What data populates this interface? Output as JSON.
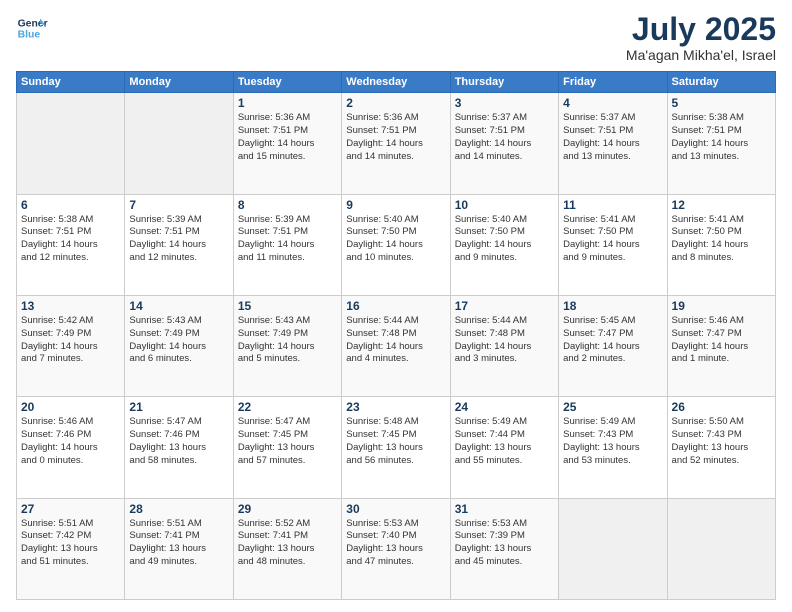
{
  "logo": {
    "line1": "General",
    "line2": "Blue"
  },
  "title": "July 2025",
  "subtitle": "Ma'agan Mikha'el, Israel",
  "days_header": [
    "Sunday",
    "Monday",
    "Tuesday",
    "Wednesday",
    "Thursday",
    "Friday",
    "Saturday"
  ],
  "weeks": [
    [
      {
        "day": "",
        "sunrise": "",
        "sunset": "",
        "daylight": ""
      },
      {
        "day": "",
        "sunrise": "",
        "sunset": "",
        "daylight": ""
      },
      {
        "day": "1",
        "sunrise": "Sunrise: 5:36 AM",
        "sunset": "Sunset: 7:51 PM",
        "daylight": "Daylight: 14 hours and 15 minutes."
      },
      {
        "day": "2",
        "sunrise": "Sunrise: 5:36 AM",
        "sunset": "Sunset: 7:51 PM",
        "daylight": "Daylight: 14 hours and 14 minutes."
      },
      {
        "day": "3",
        "sunrise": "Sunrise: 5:37 AM",
        "sunset": "Sunset: 7:51 PM",
        "daylight": "Daylight: 14 hours and 14 minutes."
      },
      {
        "day": "4",
        "sunrise": "Sunrise: 5:37 AM",
        "sunset": "Sunset: 7:51 PM",
        "daylight": "Daylight: 14 hours and 13 minutes."
      },
      {
        "day": "5",
        "sunrise": "Sunrise: 5:38 AM",
        "sunset": "Sunset: 7:51 PM",
        "daylight": "Daylight: 14 hours and 13 minutes."
      }
    ],
    [
      {
        "day": "6",
        "sunrise": "Sunrise: 5:38 AM",
        "sunset": "Sunset: 7:51 PM",
        "daylight": "Daylight: 14 hours and 12 minutes."
      },
      {
        "day": "7",
        "sunrise": "Sunrise: 5:39 AM",
        "sunset": "Sunset: 7:51 PM",
        "daylight": "Daylight: 14 hours and 12 minutes."
      },
      {
        "day": "8",
        "sunrise": "Sunrise: 5:39 AM",
        "sunset": "Sunset: 7:51 PM",
        "daylight": "Daylight: 14 hours and 11 minutes."
      },
      {
        "day": "9",
        "sunrise": "Sunrise: 5:40 AM",
        "sunset": "Sunset: 7:50 PM",
        "daylight": "Daylight: 14 hours and 10 minutes."
      },
      {
        "day": "10",
        "sunrise": "Sunrise: 5:40 AM",
        "sunset": "Sunset: 7:50 PM",
        "daylight": "Daylight: 14 hours and 9 minutes."
      },
      {
        "day": "11",
        "sunrise": "Sunrise: 5:41 AM",
        "sunset": "Sunset: 7:50 PM",
        "daylight": "Daylight: 14 hours and 9 minutes."
      },
      {
        "day": "12",
        "sunrise": "Sunrise: 5:41 AM",
        "sunset": "Sunset: 7:50 PM",
        "daylight": "Daylight: 14 hours and 8 minutes."
      }
    ],
    [
      {
        "day": "13",
        "sunrise": "Sunrise: 5:42 AM",
        "sunset": "Sunset: 7:49 PM",
        "daylight": "Daylight: 14 hours and 7 minutes."
      },
      {
        "day": "14",
        "sunrise": "Sunrise: 5:43 AM",
        "sunset": "Sunset: 7:49 PM",
        "daylight": "Daylight: 14 hours and 6 minutes."
      },
      {
        "day": "15",
        "sunrise": "Sunrise: 5:43 AM",
        "sunset": "Sunset: 7:49 PM",
        "daylight": "Daylight: 14 hours and 5 minutes."
      },
      {
        "day": "16",
        "sunrise": "Sunrise: 5:44 AM",
        "sunset": "Sunset: 7:48 PM",
        "daylight": "Daylight: 14 hours and 4 minutes."
      },
      {
        "day": "17",
        "sunrise": "Sunrise: 5:44 AM",
        "sunset": "Sunset: 7:48 PM",
        "daylight": "Daylight: 14 hours and 3 minutes."
      },
      {
        "day": "18",
        "sunrise": "Sunrise: 5:45 AM",
        "sunset": "Sunset: 7:47 PM",
        "daylight": "Daylight: 14 hours and 2 minutes."
      },
      {
        "day": "19",
        "sunrise": "Sunrise: 5:46 AM",
        "sunset": "Sunset: 7:47 PM",
        "daylight": "Daylight: 14 hours and 1 minute."
      }
    ],
    [
      {
        "day": "20",
        "sunrise": "Sunrise: 5:46 AM",
        "sunset": "Sunset: 7:46 PM",
        "daylight": "Daylight: 14 hours and 0 minutes."
      },
      {
        "day": "21",
        "sunrise": "Sunrise: 5:47 AM",
        "sunset": "Sunset: 7:46 PM",
        "daylight": "Daylight: 13 hours and 58 minutes."
      },
      {
        "day": "22",
        "sunrise": "Sunrise: 5:47 AM",
        "sunset": "Sunset: 7:45 PM",
        "daylight": "Daylight: 13 hours and 57 minutes."
      },
      {
        "day": "23",
        "sunrise": "Sunrise: 5:48 AM",
        "sunset": "Sunset: 7:45 PM",
        "daylight": "Daylight: 13 hours and 56 minutes."
      },
      {
        "day": "24",
        "sunrise": "Sunrise: 5:49 AM",
        "sunset": "Sunset: 7:44 PM",
        "daylight": "Daylight: 13 hours and 55 minutes."
      },
      {
        "day": "25",
        "sunrise": "Sunrise: 5:49 AM",
        "sunset": "Sunset: 7:43 PM",
        "daylight": "Daylight: 13 hours and 53 minutes."
      },
      {
        "day": "26",
        "sunrise": "Sunrise: 5:50 AM",
        "sunset": "Sunset: 7:43 PM",
        "daylight": "Daylight: 13 hours and 52 minutes."
      }
    ],
    [
      {
        "day": "27",
        "sunrise": "Sunrise: 5:51 AM",
        "sunset": "Sunset: 7:42 PM",
        "daylight": "Daylight: 13 hours and 51 minutes."
      },
      {
        "day": "28",
        "sunrise": "Sunrise: 5:51 AM",
        "sunset": "Sunset: 7:41 PM",
        "daylight": "Daylight: 13 hours and 49 minutes."
      },
      {
        "day": "29",
        "sunrise": "Sunrise: 5:52 AM",
        "sunset": "Sunset: 7:41 PM",
        "daylight": "Daylight: 13 hours and 48 minutes."
      },
      {
        "day": "30",
        "sunrise": "Sunrise: 5:53 AM",
        "sunset": "Sunset: 7:40 PM",
        "daylight": "Daylight: 13 hours and 47 minutes."
      },
      {
        "day": "31",
        "sunrise": "Sunrise: 5:53 AM",
        "sunset": "Sunset: 7:39 PM",
        "daylight": "Daylight: 13 hours and 45 minutes."
      },
      {
        "day": "",
        "sunrise": "",
        "sunset": "",
        "daylight": ""
      },
      {
        "day": "",
        "sunrise": "",
        "sunset": "",
        "daylight": ""
      }
    ]
  ]
}
